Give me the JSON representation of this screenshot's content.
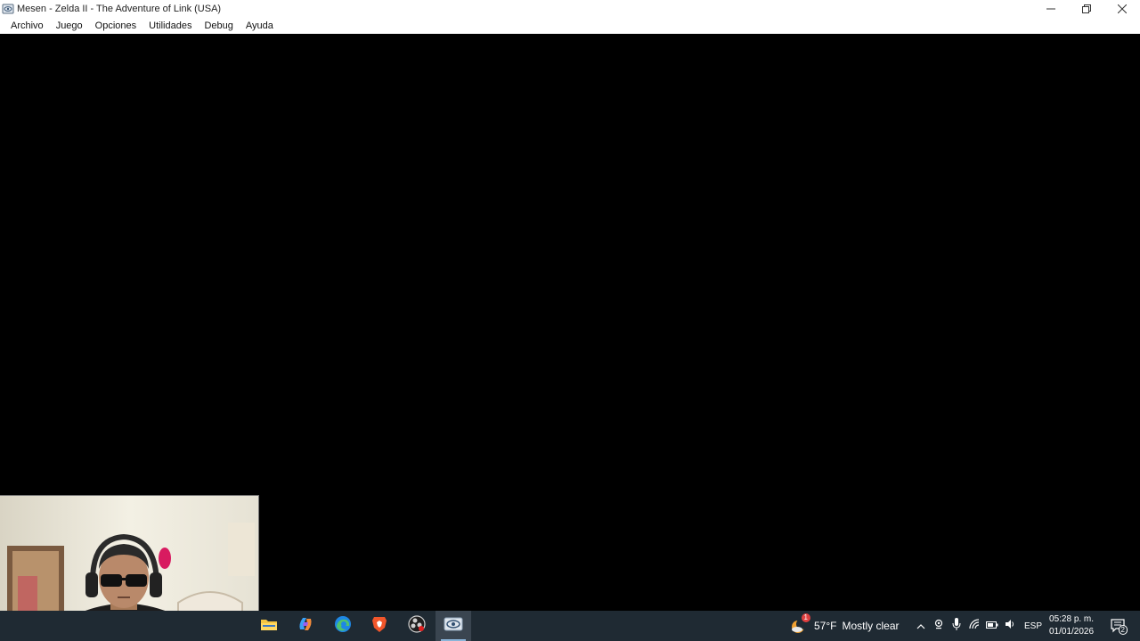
{
  "window": {
    "title": "Mesen - Zelda II - The Adventure of Link (USA)",
    "controls": {
      "minimize": "minimize-icon",
      "restore": "restore-icon",
      "close": "close-icon"
    }
  },
  "menu": {
    "items": [
      {
        "label": "Archivo"
      },
      {
        "label": "Juego"
      },
      {
        "label": "Opciones"
      },
      {
        "label": "Utilidades"
      },
      {
        "label": "Debug"
      },
      {
        "label": "Ayuda"
      }
    ]
  },
  "taskbar": {
    "apps": [
      {
        "icon": "file-explorer-icon"
      },
      {
        "icon": "copilot-icon"
      },
      {
        "icon": "edge-browser-icon"
      },
      {
        "icon": "brave-browser-icon"
      },
      {
        "icon": "obs-studio-icon"
      },
      {
        "icon": "mesen-icon",
        "active": true
      }
    ],
    "weather": {
      "temp": "57°F",
      "desc": "Mostly clear",
      "badge": "1"
    },
    "language": "ESP",
    "clock": {
      "time": "05:28 p. m.",
      "date": "01/01/2026"
    },
    "notification_count": "2"
  },
  "colors": {
    "taskbar_bg": "#1f2a33",
    "game_bg": "#000000",
    "titlebar_bg": "#ffffff"
  }
}
